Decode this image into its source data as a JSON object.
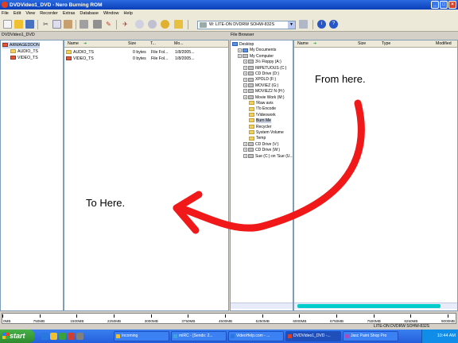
{
  "window": {
    "title": "DVDVideo1_DVD - Nero Burning ROM",
    "controls": [
      "_",
      "□",
      "×"
    ]
  },
  "menu": [
    "File",
    "Edit",
    "View",
    "Recorder",
    "Extras",
    "Database",
    "Window",
    "Help"
  ],
  "toolbar": {
    "drive": "W: LITE-ON DVDRW SOHW-832S"
  },
  "compilation": {
    "title": "DVDVideo1_DVD",
    "tree_root": "ARMAGEDDON",
    "tree_items": [
      "AUDIO_TS",
      "VIDEO_TS"
    ],
    "columns": {
      "name": "Name",
      "size": "Size",
      "type": "T...",
      "modified": "Mo..."
    },
    "rows": [
      {
        "name": "AUDIO_TS",
        "size": "0 bytes",
        "type": "File Fol...",
        "modified": "1/8/2005..."
      },
      {
        "name": "VIDEO_TS",
        "size": "0 bytes",
        "type": "File Fol...",
        "modified": "1/8/2005..."
      }
    ]
  },
  "browser": {
    "title": "File Browser",
    "tree": [
      {
        "label": "Desktop",
        "indent": 0
      },
      {
        "label": "My Documents",
        "indent": 1
      },
      {
        "label": "My Computer",
        "indent": 1
      },
      {
        "label": "3½ Floppy (A:)",
        "indent": 2
      },
      {
        "label": "IMPETUOUS (C:)",
        "indent": 2
      },
      {
        "label": "CD Drive (D:)",
        "indent": 2
      },
      {
        "label": "XPOLD (F:)",
        "indent": 2
      },
      {
        "label": "MOVIEZ (G:)",
        "indent": 2
      },
      {
        "label": "MOVIEZ2 N (H:)",
        "indent": 2
      },
      {
        "label": "Movie Work (M:)",
        "indent": 2
      },
      {
        "label": "!Raw avis",
        "indent": 3
      },
      {
        "label": "!To Encode",
        "indent": 3
      },
      {
        "label": "!Videowork",
        "indent": 3
      },
      {
        "label": "Burn Me",
        "indent": 3
      },
      {
        "label": "Recycler",
        "indent": 3
      },
      {
        "label": "System Volume",
        "indent": 3
      },
      {
        "label": "Temp",
        "indent": 3
      },
      {
        "label": "CD Drive (V:)",
        "indent": 2
      },
      {
        "label": "CD Drive (W:)",
        "indent": 2
      },
      {
        "label": "Sue (C:) on 'Sue (U...",
        "indent": 2
      }
    ],
    "columns": {
      "name": "Name",
      "size": "Size",
      "type": "Type",
      "modified": "Modified"
    }
  },
  "annotations": {
    "from": "From here.",
    "to": "To Here."
  },
  "capacity": {
    "ticks": [
      "0MB",
      "750MB",
      "1500MB",
      "2250MB",
      "3000MB",
      "3750MB",
      "4500MB",
      "5250MB",
      "6000MB",
      "6750MB",
      "7500MB",
      "8250MB",
      "9000MB"
    ]
  },
  "status": {
    "drive": "LITE-ON DVDRW SOHW-832S"
  },
  "taskbar": {
    "start": "start",
    "tasks": [
      "Incoming",
      "mIRC - [Sends: 2...",
      "VideoHelp.com - ...",
      "DVDVideo1_DVD -...",
      "Jasc Paint Shop Pro"
    ],
    "time": "10:44 AM"
  },
  "colors": {
    "arrow": "#f01818",
    "titlebar": "#0a3fb8",
    "capacity_bar": "#00cccc"
  }
}
